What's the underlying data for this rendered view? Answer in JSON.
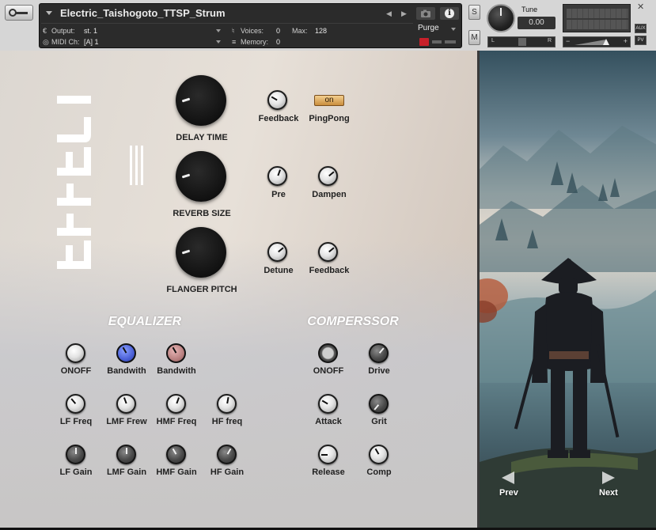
{
  "header": {
    "instrument_name": "Electric_Taishogoto_TTSP_Strum",
    "output_label": "Output:",
    "output_value": "st. 1",
    "midi_label": "MIDI Ch:",
    "midi_value": "[A]  1",
    "voices_label": "Voices:",
    "voices_value": "0",
    "max_label": "Max:",
    "max_value": "128",
    "memory_label": "Memory:",
    "memory_value": "0",
    "purge_label": "Purge",
    "solo_label": "S",
    "mute_label": "M",
    "tune_label": "Tune",
    "tune_value": "0.00",
    "pan_left": "L",
    "pan_right": "R",
    "vol_minus": "−",
    "vol_plus": "+",
    "aux_label": "AUX",
    "pv_label": "PV"
  },
  "effects": {
    "delay_time_label": "DELAY TIME",
    "reverb_size_label": "REVERB SIZE",
    "flanger_pitch_label": "FLANGER PITCH",
    "feedback_label": "Feedback",
    "pingpong_label": "PingPong",
    "pingpong_state": "on",
    "pre_label": "Pre",
    "dampen_label": "Dampen",
    "detune_label": "Detune",
    "flanger_feedback_label": "Feedback"
  },
  "equalizer": {
    "title": "EQUALIZER",
    "onoff_label": "ONOFF",
    "bandwith1_label": "Bandwith",
    "bandwith2_label": "Bandwith",
    "lf_freq_label": "LF Freq",
    "lmf_freq_label": "LMF Frew",
    "hmf_freq_label": "HMF Freq",
    "hf_freq_label": "HF freq",
    "lf_gain_label": "LF Gain",
    "lmf_gain_label": "LMF Gain",
    "hmf_gain_label": "HMF Gain",
    "hf_gain_label": "HF Gain"
  },
  "compressor": {
    "title": "COMPERSSOR",
    "onoff_label": "ONOFF",
    "drive_label": "Drive",
    "attack_label": "Attack",
    "grit_label": "Grit",
    "release_label": "Release",
    "comp_label": "Comp"
  },
  "nav": {
    "prev_label": "Prev",
    "next_label": "Next"
  }
}
